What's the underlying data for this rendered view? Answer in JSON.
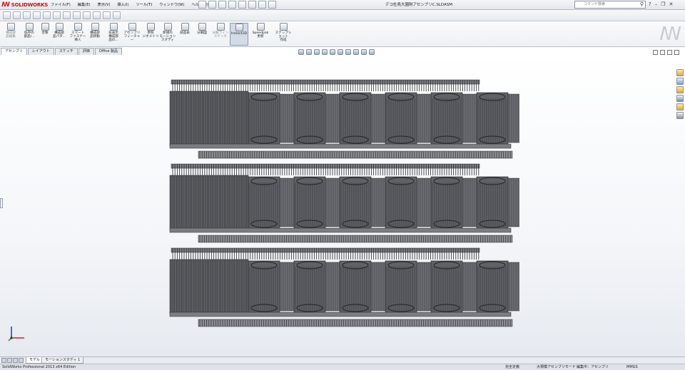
{
  "app": {
    "logo_text": "SOLIDWORKS",
    "doc_title": "デコ杜鳥大園財アセンブリC.SLDASM"
  },
  "menu": [
    "ファイル(F)",
    "編集(E)",
    "表示(V)",
    "挿入(I)",
    "ツール(T)",
    "ウィンドウ(W)",
    "ヘルプ(H)"
  ],
  "search": {
    "placeholder": "コマンド検索"
  },
  "ribbon": [
    {
      "label": "構成部\n品編集",
      "dim": true
    },
    {
      "label": "既存の\n部品/..."
    },
    {
      "label": "合致"
    },
    {
      "label": "構成部\n品パタ..."
    },
    {
      "label": "スマート\nファスナー\n挿入"
    },
    {
      "label": "構成部\n品移動"
    },
    {
      "label": "非表示\n構成部\n品の..."
    },
    {
      "label": "アセンブリ\nフィーチャー"
    },
    {
      "label": "参照\nジオメトリ"
    },
    {
      "label": "新規の\nモーション\nスタディ"
    },
    {
      "label": "部品表"
    },
    {
      "label": "分解図"
    },
    {
      "label": "分解ライン\nスケッチ",
      "dim": true
    },
    {
      "label": "Instant3D",
      "active": true
    },
    {
      "label": "Speedpak\n更新"
    },
    {
      "label": "スナップショット\n作成"
    }
  ],
  "tabs": [
    "アセンブリ",
    "レイアウト",
    "スケッチ",
    "評価",
    "Office 製品"
  ],
  "bottom_tabs": [
    "モデル",
    "モーションスタディ 1"
  ],
  "status": {
    "product": "SolidWorks Professional 2013 x64 Edition",
    "defined": "完全定義",
    "mode": "大規模アセンブリモード",
    "editing": "編集中：アセンブリ",
    "units": "MMGS"
  },
  "model": {
    "rows": 3,
    "body_color": "#5f6166",
    "edge_color": "#2a2b2e",
    "rail_color": "#7b7d82"
  }
}
